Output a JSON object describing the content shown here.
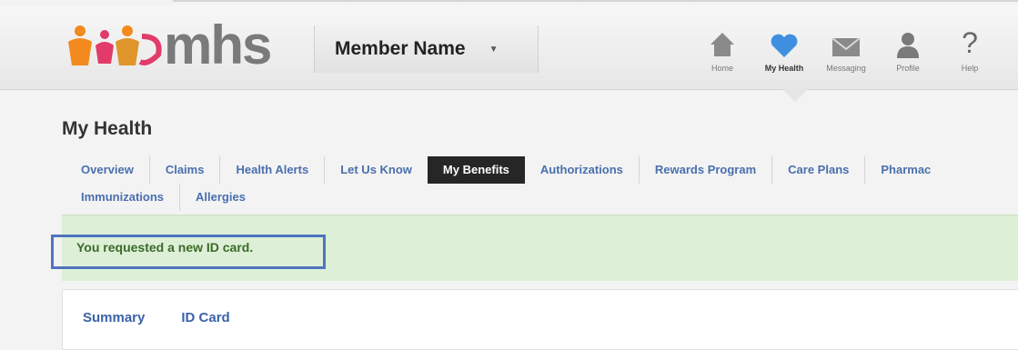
{
  "header": {
    "logo_text": "mhs",
    "member_name": "Member Name",
    "member_caret": "▼",
    "nav": [
      {
        "label": "Home",
        "icon": "home-icon"
      },
      {
        "label": "My Health",
        "icon": "heart-icon"
      },
      {
        "label": "Messaging",
        "icon": "envelope-icon"
      },
      {
        "label": "Profile",
        "icon": "person-icon"
      },
      {
        "label": "Help",
        "icon": "question-icon"
      }
    ],
    "active_nav": "My Health",
    "colors": {
      "heart": "#3f8fe0",
      "icon_gray": "#8a8a8a"
    }
  },
  "page_title": "My Health",
  "tabs": {
    "row1": [
      "Overview",
      "Claims",
      "Health Alerts",
      "Let Us Know",
      "My Benefits",
      "Authorizations",
      "Rewards Program",
      "Care Plans",
      "Pharmac"
    ],
    "row2": [
      "Immunizations",
      "Allergies"
    ],
    "active": "My Benefits"
  },
  "banner": {
    "message": "You requested a new ID card.",
    "color": "#ddefd6"
  },
  "subtabs": [
    "Summary",
    "ID Card"
  ]
}
